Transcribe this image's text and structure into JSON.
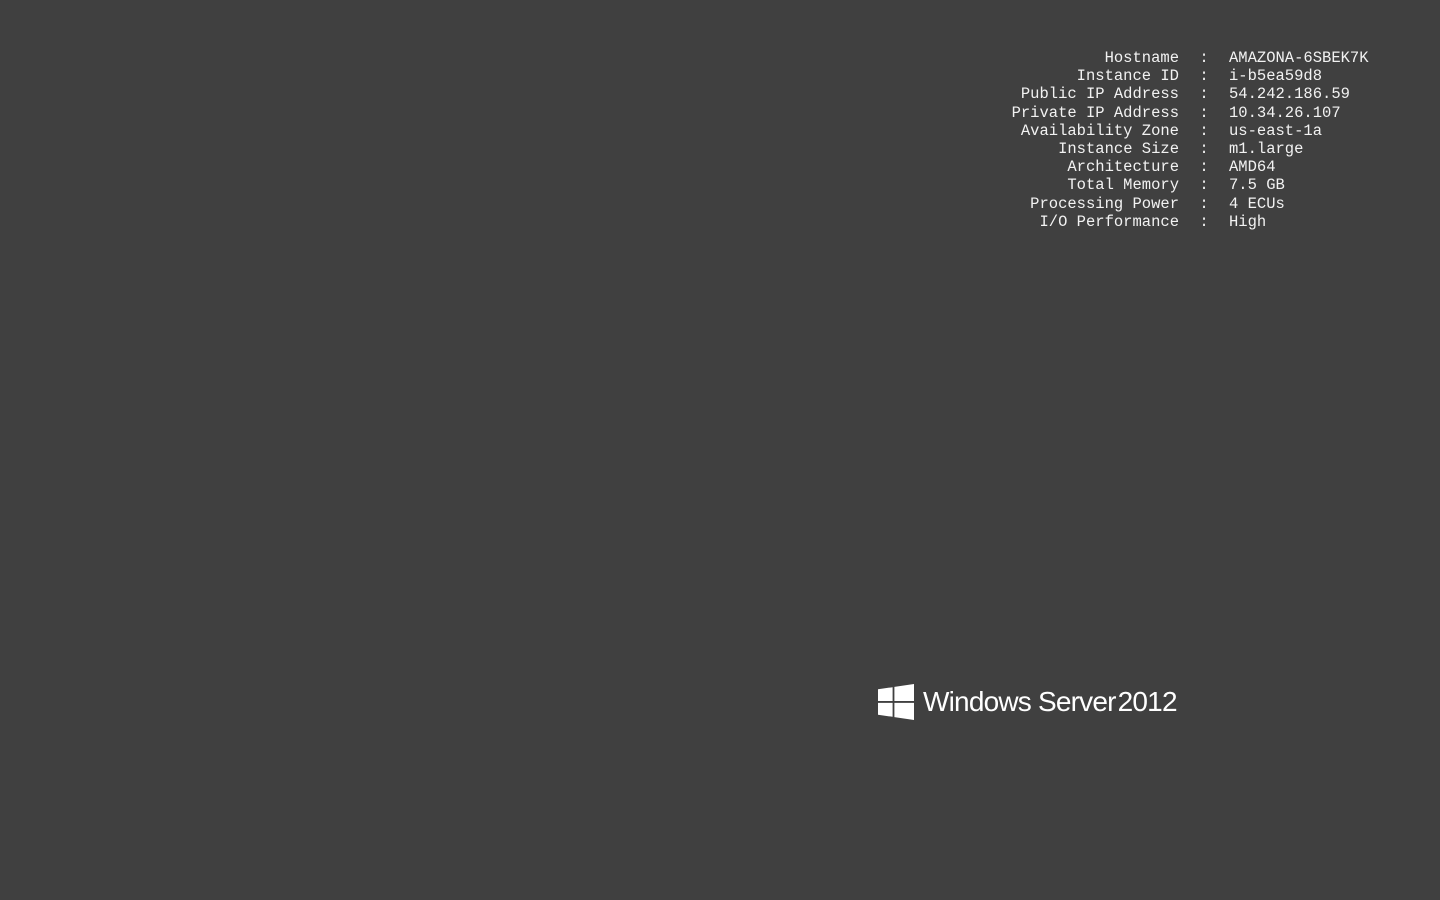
{
  "system_info": {
    "rows": [
      {
        "label": "Hostname",
        "value": "AMAZONA-6SBEK7K"
      },
      {
        "label": "Instance ID",
        "value": "i-b5ea59d8"
      },
      {
        "label": "Public IP Address",
        "value": "54.242.186.59"
      },
      {
        "label": "Private IP Address",
        "value": "10.34.26.107"
      },
      {
        "label": "Availability Zone",
        "value": "us-east-1a"
      },
      {
        "label": "Instance Size",
        "value": "m1.large"
      },
      {
        "label": "Architecture",
        "value": "AMD64"
      },
      {
        "label": "Total Memory",
        "value": "7.5 GB"
      },
      {
        "label": "Processing Power",
        "value": "4 ECUs"
      },
      {
        "label": "I/O Performance",
        "value": "High"
      }
    ],
    "separator": ":"
  },
  "branding": {
    "product_name": "Windows Server",
    "version": "2012",
    "icon": "windows-logo-icon"
  },
  "colors": {
    "background": "#404040",
    "text": "#f2f2f2"
  }
}
